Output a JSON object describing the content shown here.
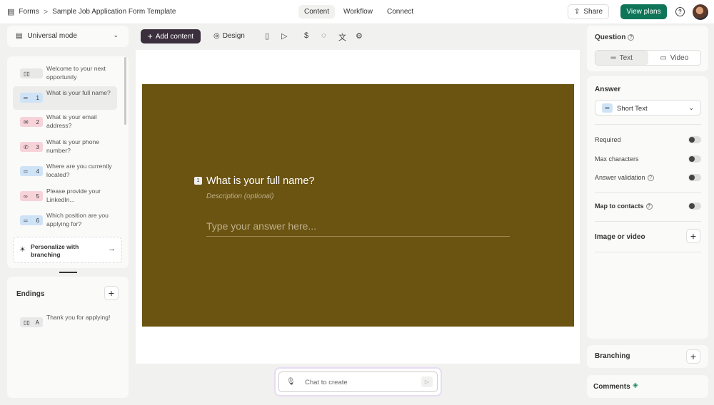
{
  "breadcrumb": {
    "root": "Forms",
    "separator": ">",
    "current": "Sample Job Application Form Template"
  },
  "nav_tabs": [
    {
      "label": "Content",
      "active": true
    },
    {
      "label": "Workflow",
      "active": false
    },
    {
      "label": "Connect",
      "active": false
    }
  ],
  "header": {
    "share_label": "Share",
    "plans_label": "View plans",
    "help_glyph": "?"
  },
  "left": {
    "mode_label": "Universal mode",
    "questions": [
      {
        "badge": "",
        "text": "Welcome to your next opportunity",
        "color": "#e8e8e8",
        "icon": "welcome-icon"
      },
      {
        "badge": "1",
        "text": "What is your full name?",
        "color": "#cfe3f7",
        "icon": "short-text-icon"
      },
      {
        "badge": "2",
        "text": "What is your email address?",
        "color": "#f7d3d9",
        "icon": "email-icon"
      },
      {
        "badge": "3",
        "text": "What is your phone number?",
        "color": "#f7d3d9",
        "icon": "phone-icon"
      },
      {
        "badge": "4",
        "text": "Where are you currently located?",
        "color": "#cfe3f7",
        "icon": "short-text-icon"
      },
      {
        "badge": "5",
        "text": "Please provide your LinkedIn...",
        "color": "#f7d3d9",
        "icon": "link-icon"
      },
      {
        "badge": "6",
        "text": "Which position are you applying for?",
        "color": "#cfe3f7",
        "icon": "short-text-icon"
      }
    ],
    "personalize_label": "Personalize with branching",
    "endings_title": "Endings",
    "ending": {
      "badge": "A",
      "text": "Thank you for applying!"
    }
  },
  "toolbar": {
    "add_label": "Add content",
    "design_label": "Design"
  },
  "slide": {
    "number": "1",
    "title": "What is your full name?",
    "description_placeholder": "Description (optional)",
    "answer_placeholder": "Type your answer here...",
    "background_color": "#6b5312"
  },
  "chat": {
    "placeholder": "Chat to create"
  },
  "right": {
    "question_title": "Question",
    "seg_text": "Text",
    "seg_video": "Video",
    "answer_title": "Answer",
    "answer_type": "Short Text",
    "required_label": "Required",
    "max_chars_label": "Max characters",
    "validation_label": "Answer validation",
    "map_contacts_label": "Map to contacts",
    "image_video_label": "Image or video",
    "branching_label": "Branching",
    "comments_label": "Comments"
  },
  "colors": {
    "accent": "#0f7558",
    "add_button": "#3b2f3e"
  }
}
